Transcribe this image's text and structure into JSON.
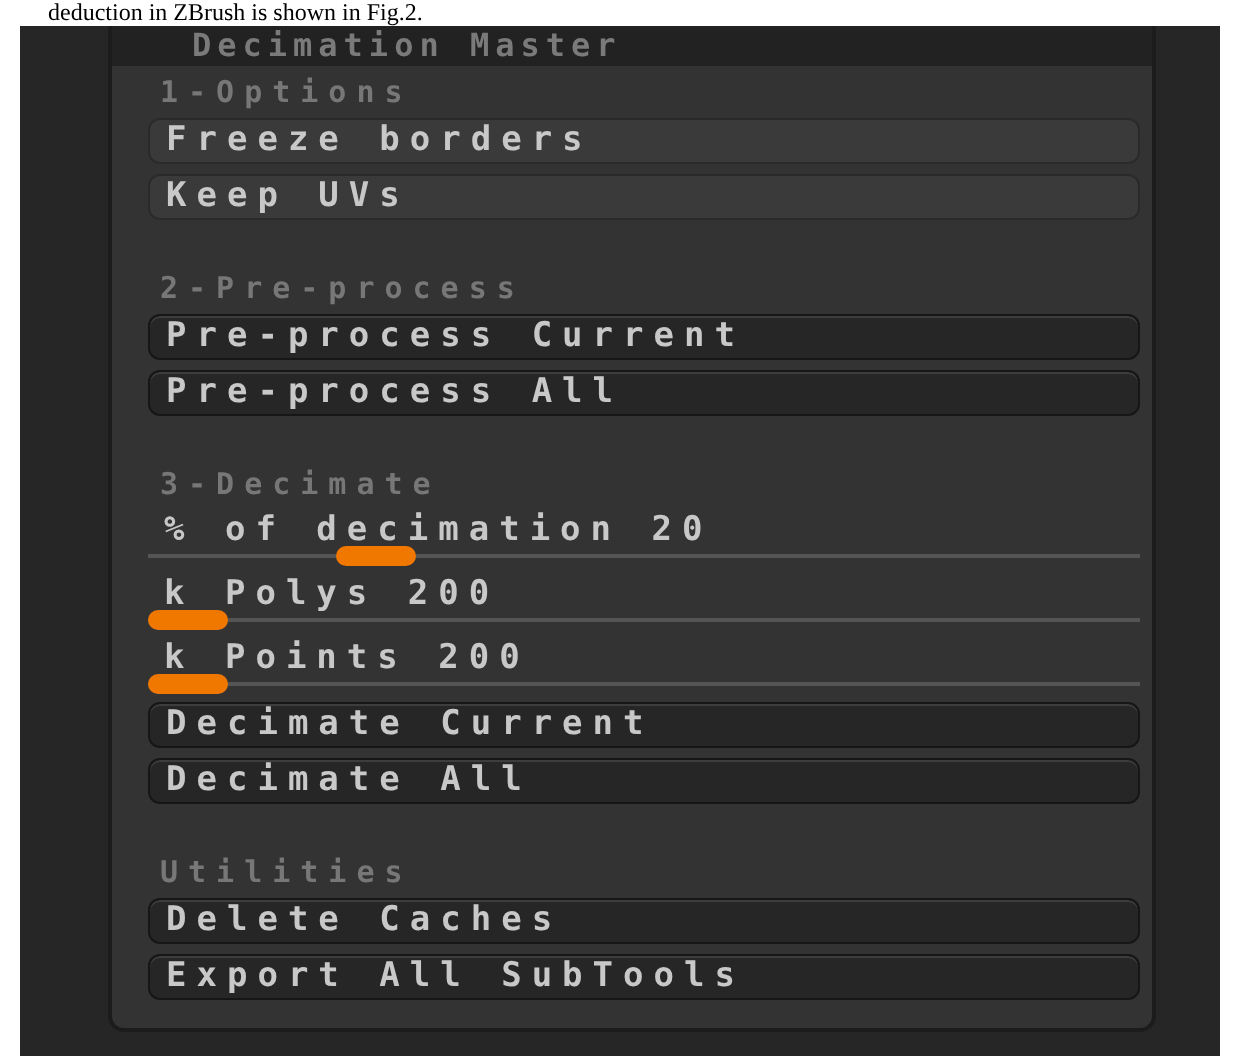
{
  "caption": "deduction in ZBrush is shown in Fig.2.",
  "panel": {
    "title": "Decimation Master"
  },
  "sections": [
    {
      "heading": "1-Options",
      "items": [
        {
          "kind": "toggle",
          "label": "Freeze borders",
          "on": false
        },
        {
          "kind": "toggle",
          "label": "Keep UVs",
          "on": false
        }
      ]
    },
    {
      "heading": "2-Pre-process",
      "items": [
        {
          "kind": "action",
          "label": "Pre-process Current"
        },
        {
          "kind": "action",
          "label": "Pre-process All"
        }
      ]
    },
    {
      "heading": "3-Decimate",
      "items": [
        {
          "kind": "slider",
          "label": "% of decimation 20",
          "level": 0.2
        },
        {
          "kind": "slider",
          "label": "k Polys 200",
          "level": 0.0
        },
        {
          "kind": "slider",
          "label": "k Points 200",
          "level": 0.0
        },
        {
          "kind": "action",
          "label": "Decimate Current"
        },
        {
          "kind": "action",
          "label": "Decimate All"
        }
      ]
    },
    {
      "heading": "Utilities",
      "items": [
        {
          "kind": "action",
          "label": "Delete Caches"
        },
        {
          "kind": "action",
          "label": "Export All SubTools"
        }
      ]
    }
  ]
}
